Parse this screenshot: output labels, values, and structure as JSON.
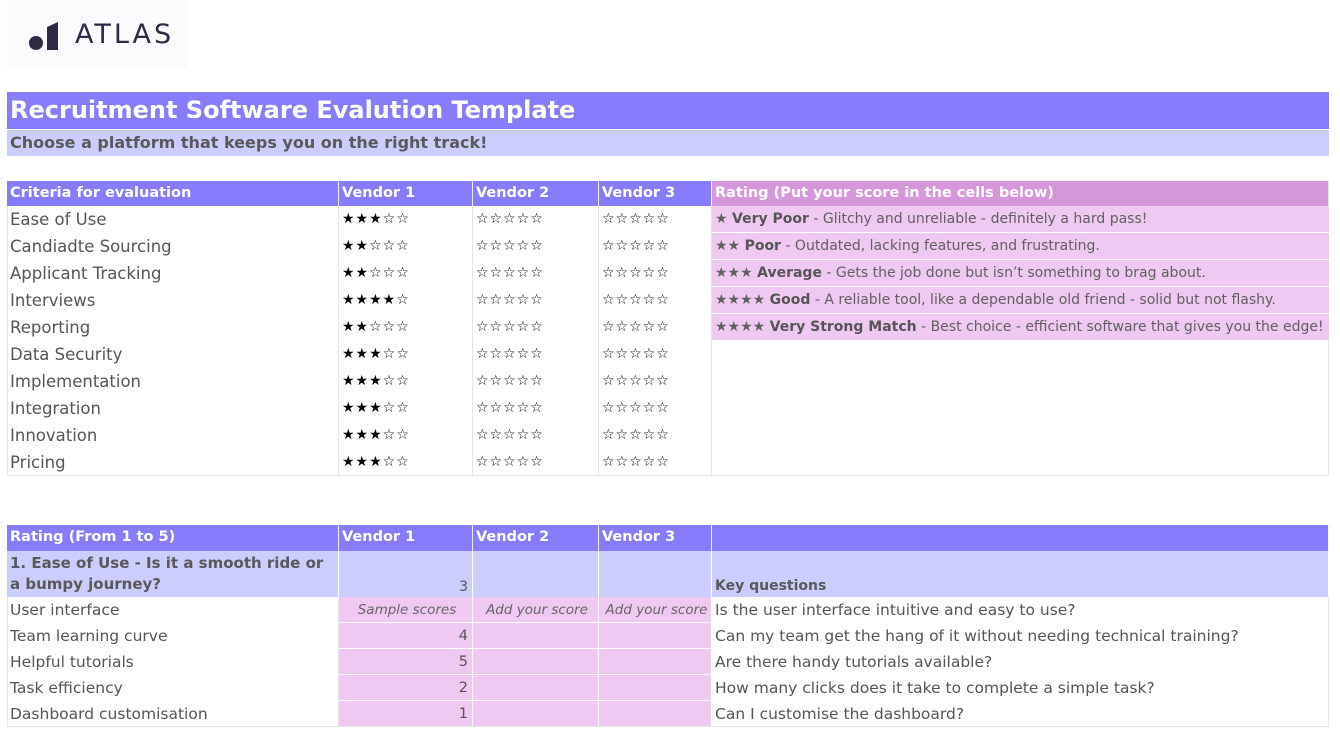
{
  "brand": {
    "name": "ATLAS",
    "logo_icon": "atlas-logo-icon"
  },
  "title": "Recruitment Software Evalution Template",
  "subtitle": "Choose a platform that keeps you on the right track!",
  "colors": {
    "header": "#877dfc",
    "subheader": "#cbcdfd",
    "rating_header": "#d696da",
    "rating_fill": "#f0c9f2"
  },
  "criteria_table": {
    "headers": {
      "criteria": "Criteria for evaluation",
      "vendor1": "Vendor 1",
      "vendor2": "Vendor 2",
      "vendor3": "Vendor 3",
      "rating": "Rating (Put your score in the cells below)"
    },
    "max_stars": 5,
    "rows": [
      {
        "criterion": "Ease of Use",
        "vendor1": 3,
        "vendor2": 0,
        "vendor3": 0
      },
      {
        "criterion": "Candiadte Sourcing",
        "vendor1": 2,
        "vendor2": 0,
        "vendor3": 0
      },
      {
        "criterion": "Applicant Tracking",
        "vendor1": 2,
        "vendor2": 0,
        "vendor3": 0
      },
      {
        "criterion": "Interviews",
        "vendor1": 4,
        "vendor2": 0,
        "vendor3": 0
      },
      {
        "criterion": "Reporting",
        "vendor1": 2,
        "vendor2": 0,
        "vendor3": 0
      },
      {
        "criterion": "Data Security",
        "vendor1": 3,
        "vendor2": 0,
        "vendor3": 0
      },
      {
        "criterion": "Implementation",
        "vendor1": 3,
        "vendor2": 0,
        "vendor3": 0
      },
      {
        "criterion": "Integration",
        "vendor1": 3,
        "vendor2": 0,
        "vendor3": 0
      },
      {
        "criterion": "Innovation",
        "vendor1": 3,
        "vendor2": 0,
        "vendor3": 0
      },
      {
        "criterion": "Pricing",
        "vendor1": 3,
        "vendor2": 0,
        "vendor3": 0
      }
    ],
    "legend": [
      {
        "stars": "★",
        "label": "Very Poor",
        "description": " - Glitchy and unreliable - definitely a hard pass!"
      },
      {
        "stars": "★★",
        "label": "Poor",
        "description": " - Outdated, lacking features, and frustrating."
      },
      {
        "stars": "★★★",
        "label": "Average",
        "description": " - Gets the job done but isn’t something to brag about."
      },
      {
        "stars": "★★★★",
        "label": "Good",
        "description": " - A reliable tool, like a dependable old friend - solid but not flashy."
      },
      {
        "stars": "★★★★",
        "label": "Very Strong Match",
        "description": " - Best choice - efficient software that gives you the edge!"
      }
    ]
  },
  "scores_table": {
    "headers": {
      "rating": "Rating (From 1 to 5)",
      "vendor1": "Vendor 1",
      "vendor2": "Vendor 2",
      "vendor3": "Vendor 3",
      "extra": ""
    },
    "section": {
      "label": "1. Ease of Use - Is it a smooth ride or a bumpy journey?",
      "vendor1_score": "3",
      "vendor2_score": "",
      "vendor3_score": "",
      "key_questions_label": "Key questions"
    },
    "hint_row": {
      "label": "User interface",
      "vendor1": "Sample scores",
      "vendor2": "Add your score",
      "vendor3": "Add your score",
      "question": "Is the user interface intuitive and easy to use?"
    },
    "rows": [
      {
        "label": "Team learning curve",
        "vendor1": "4",
        "vendor2": "",
        "vendor3": "",
        "question": "Can my team get the hang of it without needing technical training?"
      },
      {
        "label": "Helpful tutorials",
        "vendor1": "5",
        "vendor2": "",
        "vendor3": "",
        "question": "Are there handy tutorials available?"
      },
      {
        "label": "Task efficiency",
        "vendor1": "2",
        "vendor2": "",
        "vendor3": "",
        "question": "How many clicks does it take to complete a simple task?"
      },
      {
        "label": "Dashboard customisation",
        "vendor1": "1",
        "vendor2": "",
        "vendor3": "",
        "question": "Can I customise the dashboard?"
      }
    ]
  }
}
